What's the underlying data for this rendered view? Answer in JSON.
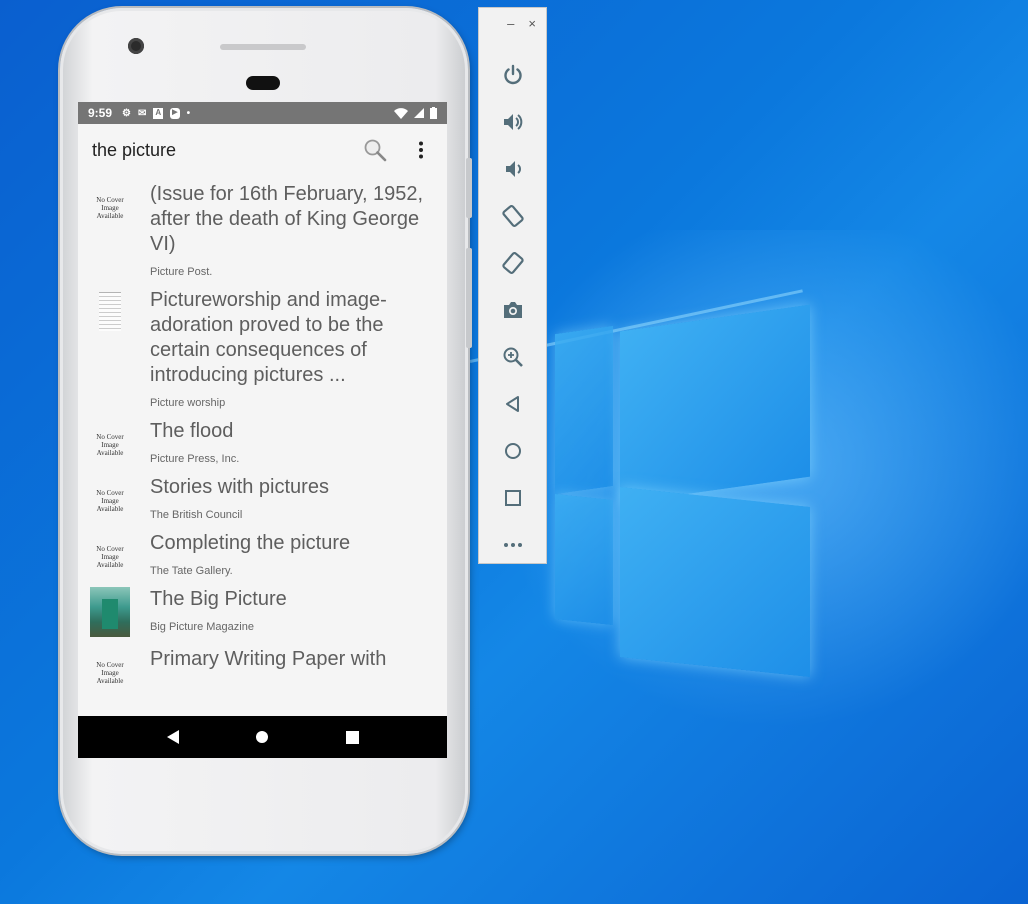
{
  "phone": {
    "status_bar": {
      "time": "9:59",
      "dot": "•"
    },
    "app_bar": {
      "title": "the picture",
      "search_icon": "search-icon",
      "menu_icon": "more-vert-icon"
    },
    "no_cover_text": "No Cover Image Available",
    "items": [
      {
        "title": "(Issue for 16th February, 1952, after the death of King George VI)",
        "subtitle": "Picture Post.",
        "thumb": "no-cover"
      },
      {
        "title": "Pictureworship and image-adoration proved to be the certain consequences of introducing pictures ...",
        "subtitle": "Picture worship",
        "thumb": "document"
      },
      {
        "title": "The flood",
        "subtitle": "Picture Press, Inc.",
        "thumb": "no-cover"
      },
      {
        "title": "Stories with pictures",
        "subtitle": "The British Council",
        "thumb": "no-cover"
      },
      {
        "title": "Completing the picture",
        "subtitle": "The Tate Gallery.",
        "thumb": "no-cover"
      },
      {
        "title": "The Big Picture",
        "subtitle": "Big Picture Magazine",
        "thumb": "cover-image"
      },
      {
        "title": "Primary Writing Paper with",
        "subtitle": "",
        "thumb": "no-cover"
      }
    ],
    "nav": [
      "back-icon",
      "home-icon",
      "recents-icon"
    ]
  },
  "emulator_toolbar": {
    "minimize": "–",
    "close": "×",
    "buttons": [
      "power-icon",
      "volume-up-icon",
      "volume-down-icon",
      "rotate-left-icon",
      "rotate-right-icon",
      "camera-icon",
      "zoom-icon",
      "back-icon",
      "home-icon",
      "overview-icon",
      "more-icon"
    ]
  },
  "colors": {
    "status_bar": "#757575",
    "screen_bg": "#f5f5f5",
    "nav_bar": "#000000",
    "toolbar_icon": "#546e7a",
    "desktop": "#0b78dd"
  }
}
